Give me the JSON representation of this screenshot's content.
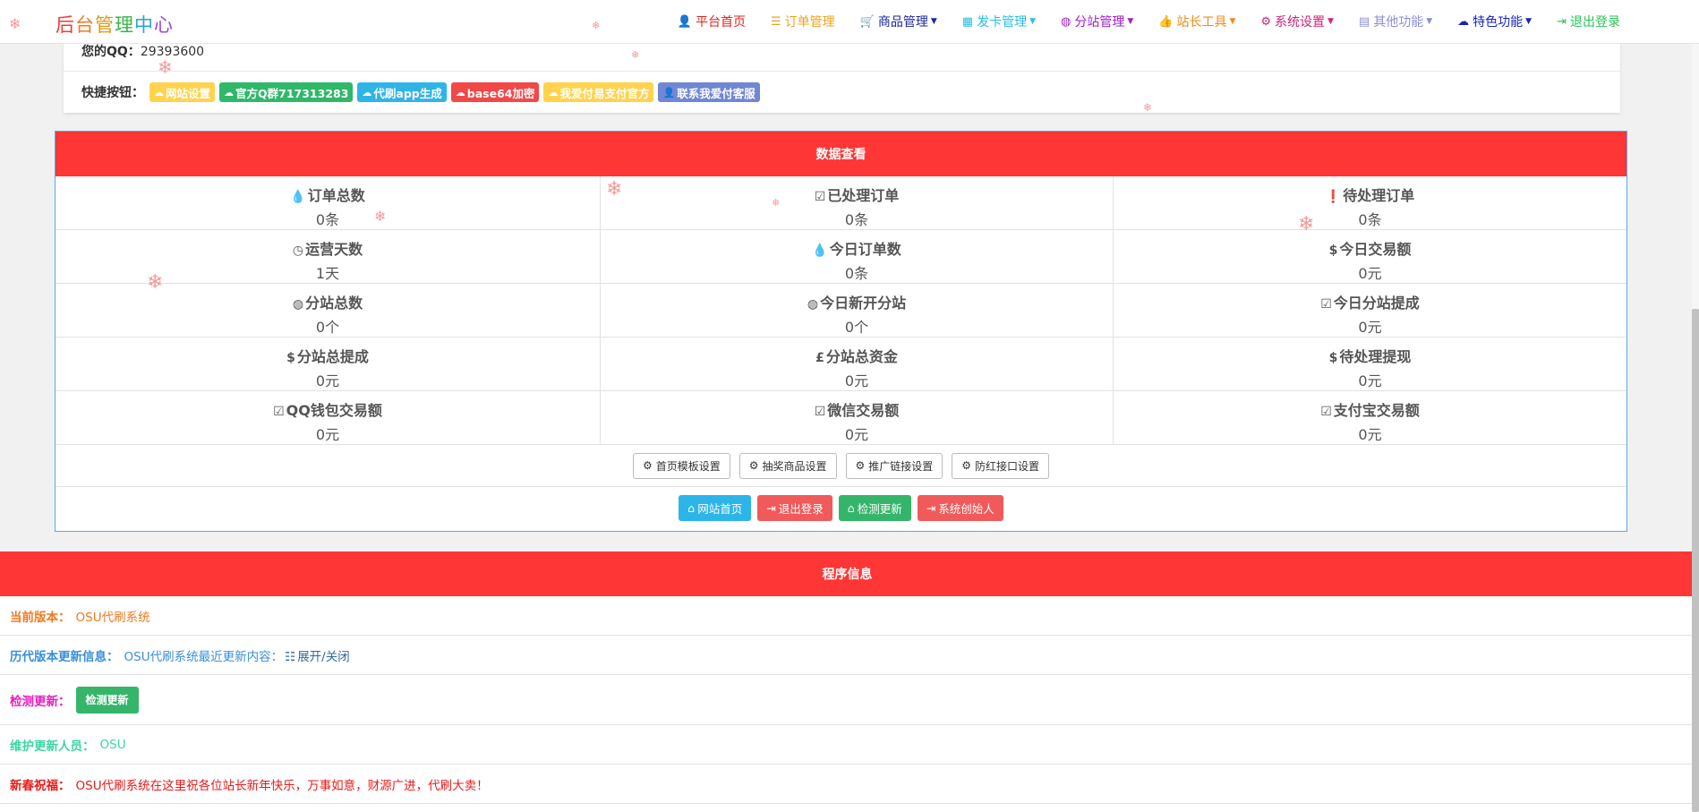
{
  "brand": {
    "chars": [
      {
        "t": "后",
        "c": "#f13b3b"
      },
      {
        "t": "台",
        "c": "#f07a22"
      },
      {
        "t": "管",
        "c": "#d89a14"
      },
      {
        "t": "理",
        "c": "#3bb54a"
      },
      {
        "t": "中",
        "c": "#2aa0d8"
      },
      {
        "t": "心",
        "c": "#9b48d8"
      }
    ]
  },
  "nav": [
    {
      "label": "平台首页",
      "icon": "👤",
      "color": "#e8231b",
      "caret": false
    },
    {
      "label": "订单管理",
      "icon": "☰",
      "color": "#f0a31f",
      "caret": false
    },
    {
      "label": "商品管理",
      "icon": "🛒",
      "color": "#1a2a9a",
      "caret": true
    },
    {
      "label": "发卡管理",
      "icon": "▦",
      "color": "#27bfe6",
      "caret": true
    },
    {
      "label": "分站管理",
      "icon": "◍",
      "color": "#a21fd0",
      "caret": true
    },
    {
      "label": "站长工具",
      "icon": "👍",
      "color": "#f08a1c",
      "caret": true
    },
    {
      "label": "系统设置",
      "icon": "⚙",
      "color": "#d0237a",
      "caret": true
    },
    {
      "label": "其他功能",
      "icon": "▤",
      "color": "#8a8ed8",
      "caret": true
    },
    {
      "label": "特色功能",
      "icon": "☁",
      "color": "#1a24b8",
      "caret": true
    },
    {
      "label": "退出登录",
      "icon": "⇥",
      "color": "#27c455",
      "caret": false
    }
  ],
  "user": {
    "qq_label": "您的QQ：",
    "qq_value": "29393600",
    "quick_label": "快捷按钮：",
    "quick_buttons": [
      {
        "label": "网站设置",
        "color": "#ffd34d"
      },
      {
        "label": "官方Q群717313283",
        "color": "#2fb86a"
      },
      {
        "label": "代刷app生成",
        "color": "#2fb4e8"
      },
      {
        "label": "base64加密",
        "color": "#f24848"
      },
      {
        "label": "我爱付易支付官方",
        "color": "#ffd34d"
      },
      {
        "label": "联系我爱付客服",
        "color": "#7186d4"
      }
    ]
  },
  "data_panel": {
    "title": "数据查看",
    "stats": [
      {
        "icon": "💧",
        "label": "订单总数",
        "value": "0条"
      },
      {
        "icon": "☑",
        "label": "已处理订单",
        "value": "0条"
      },
      {
        "icon": "❗",
        "label": "待处理订单",
        "value": "0条"
      },
      {
        "icon": "◷",
        "label": "运营天数",
        "value": "1天"
      },
      {
        "icon": "💧",
        "label": "今日订单数",
        "value": "0条"
      },
      {
        "icon": "$",
        "label": "今日交易额",
        "value": "0元"
      },
      {
        "icon": "◍",
        "label": "分站总数",
        "value": "0个"
      },
      {
        "icon": "◍",
        "label": "今日新开分站",
        "value": "0个"
      },
      {
        "icon": "☑",
        "label": "今日分站提成",
        "value": "0元"
      },
      {
        "icon": "$",
        "label": "分站总提成",
        "value": "0元"
      },
      {
        "icon": "£",
        "label": "分站总资金",
        "value": "0元"
      },
      {
        "icon": "$",
        "label": "待处理提现",
        "value": "0元"
      },
      {
        "icon": "☑",
        "label": "QQ钱包交易额",
        "value": "0元"
      },
      {
        "icon": "☑",
        "label": "微信交易额",
        "value": "0元"
      },
      {
        "icon": "☑",
        "label": "支付宝交易额",
        "value": "0元"
      }
    ],
    "settings_buttons": [
      "首页模板设置",
      "抽奖商品设置",
      "推广链接设置",
      "防红接口设置"
    ],
    "action_buttons": [
      {
        "label": "网站首页",
        "icon": "⌂",
        "color": "#2cb5e8"
      },
      {
        "label": "退出登录",
        "icon": "⇥",
        "color": "#f05a5a"
      },
      {
        "label": "检测更新",
        "icon": "⌂",
        "color": "#35b56a"
      },
      {
        "label": "系统创始人",
        "icon": "⇥",
        "color": "#f05a5a"
      }
    ]
  },
  "info_panel": {
    "title": "程序信息",
    "version_label": "当前版本：",
    "version_value": "OSU代刷系统",
    "history_label": "历代版本更新信息：",
    "history_value": "OSU代刷系统最近更新内容：",
    "history_toggle": "展开/关闭",
    "check_label": "检测更新：",
    "check_button": "检测更新",
    "maintainer_label": "维护更新人员：",
    "maintainer_value": "OSU",
    "greeting_label": "新春祝福：",
    "greeting_value": "OSU代刷系统在这里祝各位站长新年快乐，万事如意，财源广进，代刷大卖！",
    "colors": {
      "version": "#f07a22",
      "history": "#3a8fd8",
      "check": "#e81bc4",
      "maintainer": "#3ad6a0",
      "greeting": "#e81b1b"
    }
  }
}
